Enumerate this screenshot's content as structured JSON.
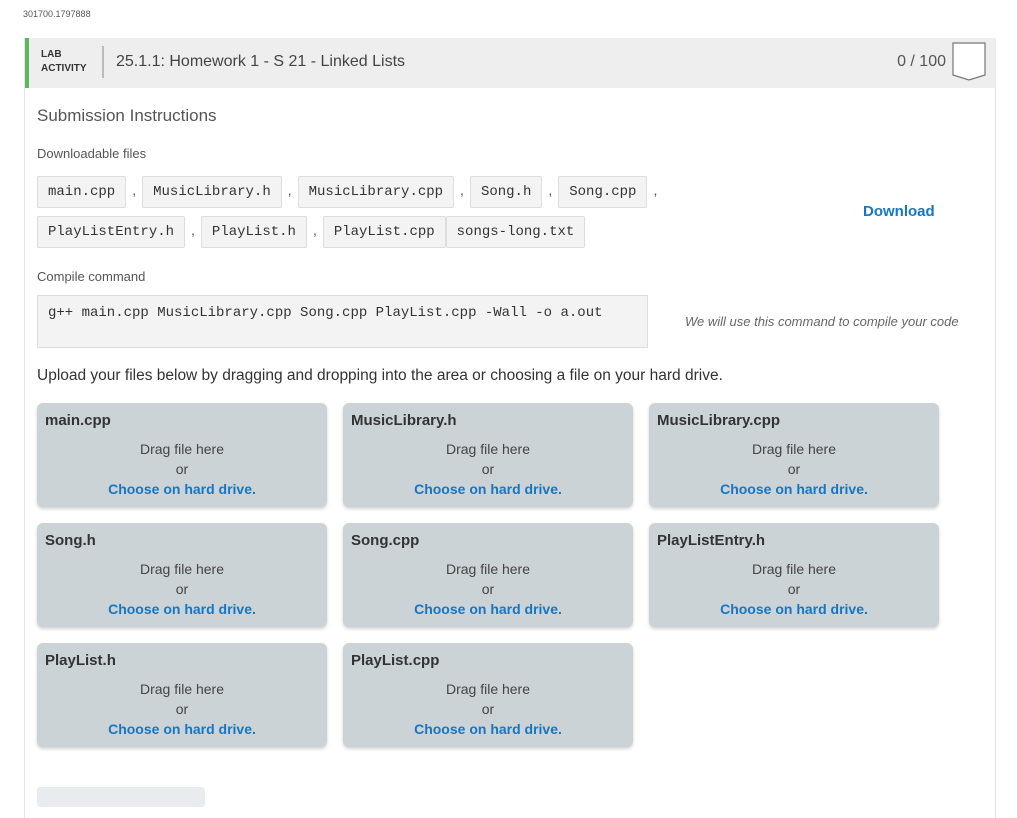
{
  "page_id": "301700.1797888",
  "header": {
    "lab_line1": "LAB",
    "lab_line2": "ACTIVITY",
    "title": "25.1.1: Homework 1 - S 21 - Linked Lists",
    "score": "0 / 100"
  },
  "section_title": "Submission Instructions",
  "downloadable_label": "Downloadable files",
  "files": [
    "main.cpp",
    "MusicLibrary.h",
    "MusicLibrary.cpp",
    "Song.h",
    "Song.cpp",
    "PlayListEntry.h",
    "PlayList.h",
    "PlayList.cpp",
    "songs-long.txt"
  ],
  "comma": ",",
  "download_label": "Download",
  "compile_label": "Compile command",
  "compile_command": "g++ main.cpp MusicLibrary.cpp Song.cpp PlayList.cpp -Wall -o a.out",
  "compile_note": "We will use this command to compile your code",
  "upload_instructions": "Upload your files below by dragging and dropping into the area or choosing a file on your hard drive.",
  "drop_text": {
    "drag": "Drag file here",
    "or": "or",
    "choose": "Choose on hard drive."
  },
  "upload_files": [
    "main.cpp",
    "MusicLibrary.h",
    "MusicLibrary.cpp",
    "Song.h",
    "Song.cpp",
    "PlayListEntry.h",
    "PlayList.h",
    "PlayList.cpp"
  ]
}
